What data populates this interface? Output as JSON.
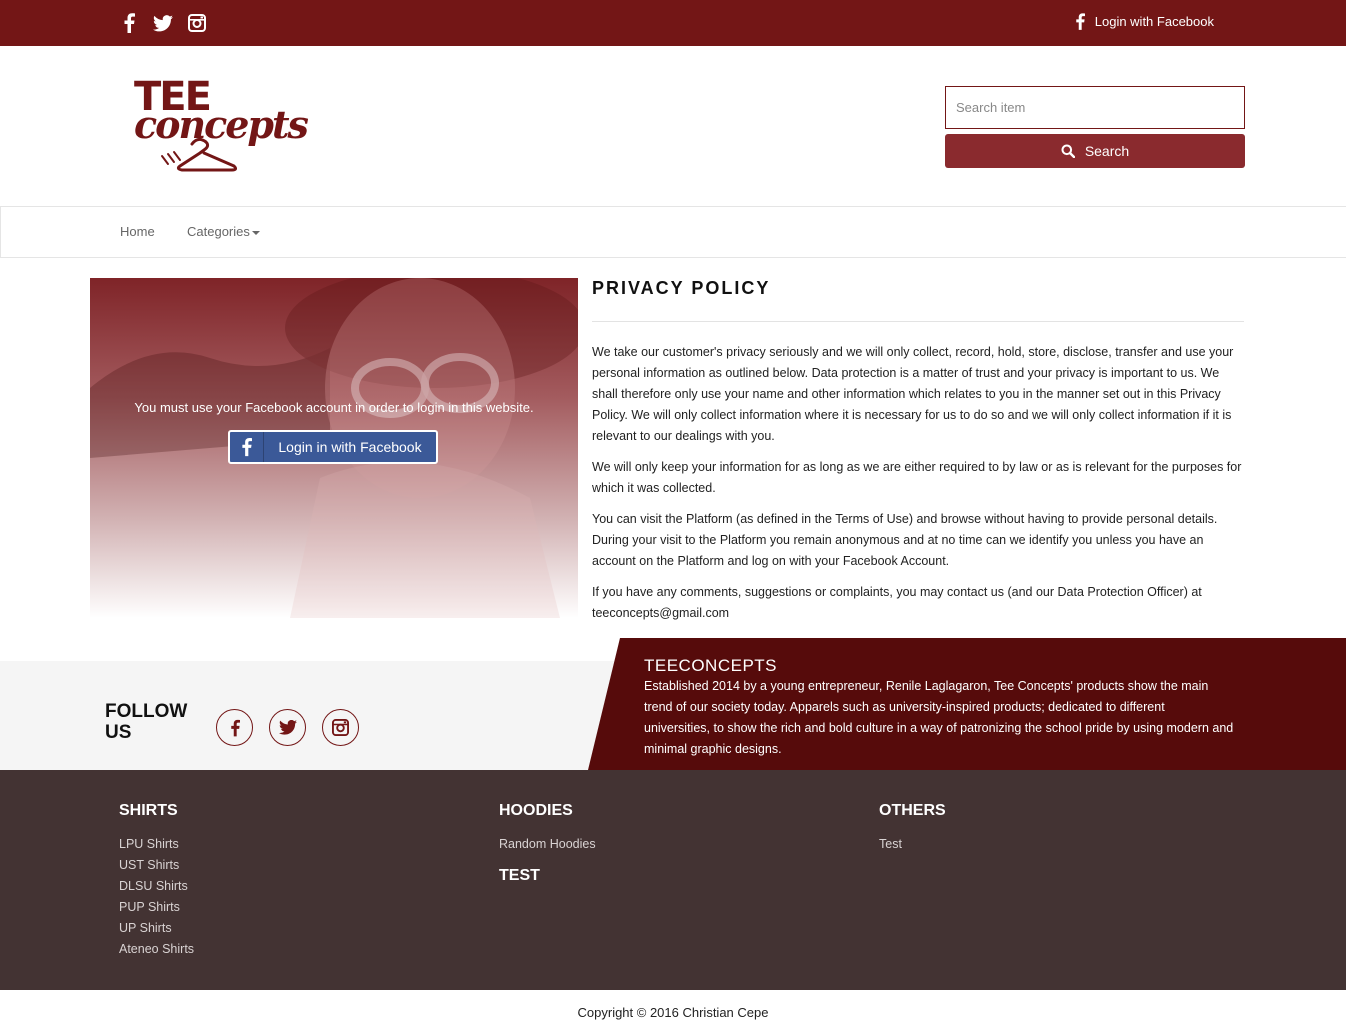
{
  "topbar": {
    "social_icons": [
      "facebook-icon",
      "twitter-icon",
      "instagram-icon"
    ],
    "login_label": "Login with Facebook"
  },
  "header": {
    "logo_text_top": "TEE",
    "logo_text_bottom": "concepts",
    "search_placeholder": "Search item",
    "search_button": "Search"
  },
  "nav": {
    "home": "Home",
    "categories": "Categories"
  },
  "login_panel": {
    "message": "You must use your Facebook account in order to login in this website.",
    "button": "Login in with Facebook"
  },
  "policy": {
    "title": "PRIVACY POLICY",
    "paragraphs": [
      "We take our customer's privacy seriously and we will only collect, record, hold, store, disclose, transfer and use your personal information as outlined below. Data protection is a matter of trust and your privacy is important to us. We shall therefore only use your name and other information which relates to you in the manner set out in this Privacy Policy. We will only collect information where it is necessary for us to do so and we will only collect information if it is relevant to our dealings with you.",
      "We will only keep your information for as long as we are either required to by law or as is relevant for the purposes for which it was collected.",
      "You can visit the Platform (as defined in the Terms of Use) and browse without having to provide personal details. During your visit to the Platform you remain anonymous and at no time can we identify you unless you have an account on the Platform and log on with your Facebook Account.",
      "If you have any comments, suggestions or complaints, you may contact us (and our Data Protection Officer) at teeconcepts@gmail.com"
    ]
  },
  "follow": {
    "title_line1": "FOLLOW",
    "title_line2": "US"
  },
  "about": {
    "title": "TEECONCEPTS",
    "text": "Established 2014 by a young entrepreneur, Renile Laglagaron, Tee Concepts' products show the main trend of our society today. Apparels such as university-inspired products; dedicated to different universities, to show the rich and bold culture in a way of patronizing the school pride by using modern and minimal graphic designs."
  },
  "footer": {
    "shirts": {
      "title": "SHIRTS",
      "links": [
        "LPU Shirts",
        "UST Shirts",
        "DLSU Shirts",
        "PUP Shirts",
        "UP Shirts",
        "Ateneo Shirts"
      ]
    },
    "hoodies": {
      "title": "HOODIES",
      "links": [
        "Random Hoodies"
      ]
    },
    "test": {
      "title": "TEST"
    },
    "others": {
      "title": "OTHERS",
      "links": [
        "Test"
      ]
    }
  },
  "copyright": "Copyright © 2016 Christian Cepe",
  "colors": {
    "brand": "#731616",
    "button": "#8a2a2e",
    "about_bg": "#560b0b",
    "footer_bg": "#433333",
    "facebook": "#3b5998"
  }
}
